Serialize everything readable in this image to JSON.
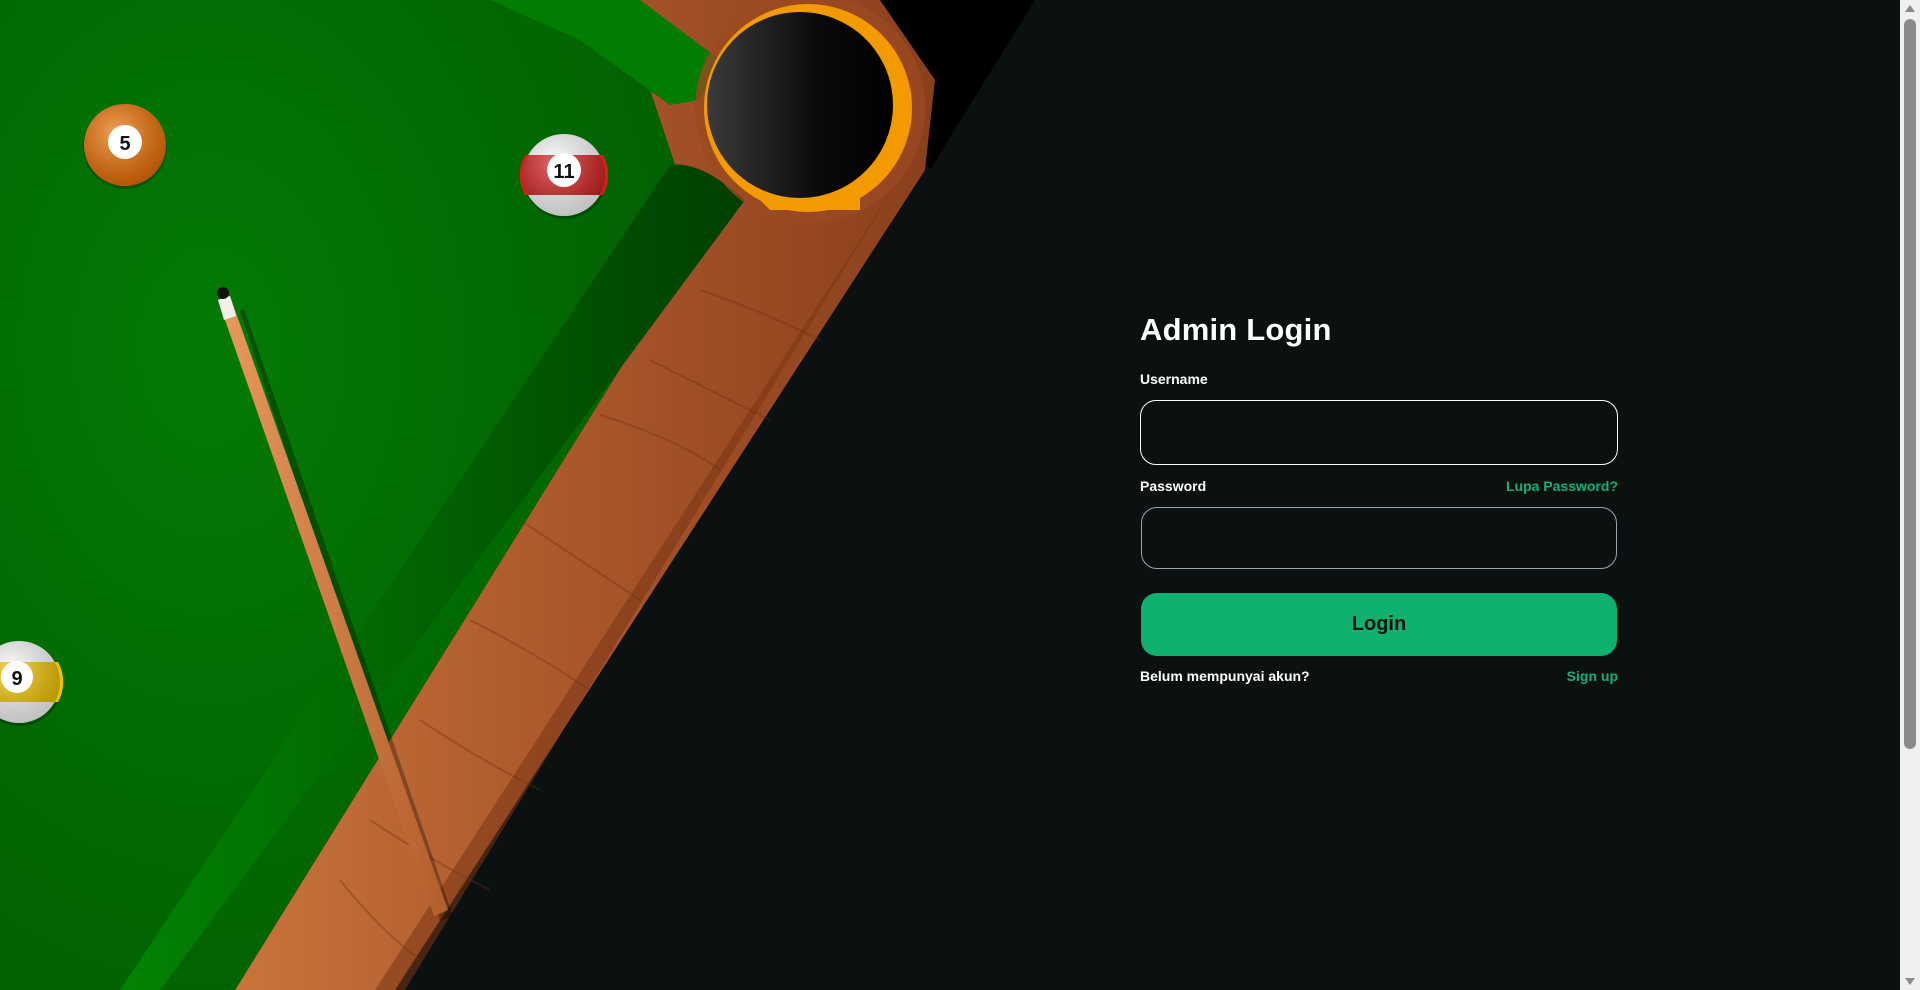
{
  "illustration": {
    "balls": [
      {
        "number": "5",
        "color": "#ee6f00"
      },
      {
        "number": "11",
        "color": "#d41d1d"
      },
      {
        "number": "9",
        "color": "#f2c400"
      }
    ]
  },
  "login": {
    "title": "Admin Login",
    "username_label": "Username",
    "username_value": "",
    "password_label": "Password",
    "password_value": "",
    "forgot_label": "Lupa Password?",
    "submit_label": "Login",
    "no_account_text": "Belum mempunyai akun?",
    "signup_label": "Sign up"
  },
  "colors": {
    "background": "#0b1111",
    "accent": "#0fb16f",
    "accent_text": "#13b077",
    "felt": "#026a02",
    "wood": "#a0522d"
  },
  "icons": {
    "scroll_up": "triangle-up-icon",
    "scroll_down": "triangle-down-icon"
  }
}
